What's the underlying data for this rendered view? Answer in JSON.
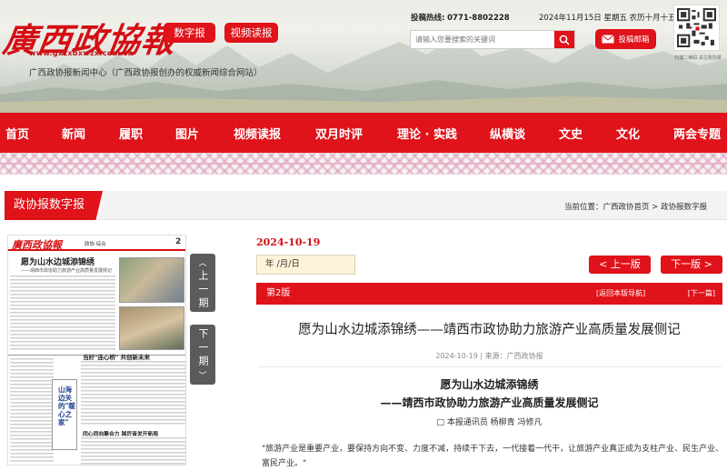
{
  "header": {
    "logo_text": "廣西政協報",
    "logo_url": "www.gxzxbxwzx.com.cn",
    "site_desc": "广西政协报新闻中心（广西政协报创办的权威新闻综合网站）",
    "digital_label": "数字报",
    "video_label": "视频读报",
    "hotline_label": "投稿热线:",
    "hotline": "0771-8802228",
    "date_text": "2024年11月15日 星期五 农历十月十五",
    "search_placeholder": "请输入您要搜索的关键词",
    "submit_label": "投稿邮箱",
    "qr_label": "扫描二维码 关注政协报"
  },
  "nav": [
    "首页",
    "新闻",
    "履职",
    "图片",
    "视频读报",
    "双月时评",
    "理论 · 实践",
    "纵横谈",
    "文史",
    "文化",
    "两会专题"
  ],
  "section": {
    "title": "政协报数字报",
    "breadcrumb": "当前位置：广西政协首页 > 政协报数字报"
  },
  "paper": {
    "masthead": "廣西政協報",
    "page_tag": "政协·综合",
    "page_no": "2",
    "headline": "愿为山水边城添锦绣",
    "subhead": "——靖西市政协助力旅游产业高质量发展侧记",
    "box1": "当好\"连心桥\" 共创新未来",
    "box2": "同心同向聚合力 踔厉奋发开新局",
    "side": "山海边关的\"暖心之家\""
  },
  "pager": {
    "prev": "上一期",
    "next": "下一期"
  },
  "issue": {
    "date": "2024-10-19",
    "date_input": "年 /月/日",
    "prev_page": "< 上一版",
    "next_page": "下一版 >",
    "edition": "第2版",
    "back_nav": "[返回本版导航]",
    "next_article": "[下一篇]"
  },
  "article": {
    "title": "愿为山水边城添锦绣——靖西市政协助力旅游产业高质量发展侧记",
    "meta": "2024-10-19 | 来源：广西政协报",
    "heading": "愿为山水边城添锦绣",
    "subheading": "——靖西市政协助力旅游产业高质量发展侧记",
    "author": "□ 本报通讯员 杨柳青 冯修凡",
    "body": "\"旅游产业是重要产业，要保持方向不变、力度不减，持续干下去，一代接着一代干，让旅游产业真正成为支柱产业、民生产业、富民产业。\""
  },
  "colors": {
    "brand_red": "#e0121a",
    "dark_gray": "#5b5b5b"
  }
}
